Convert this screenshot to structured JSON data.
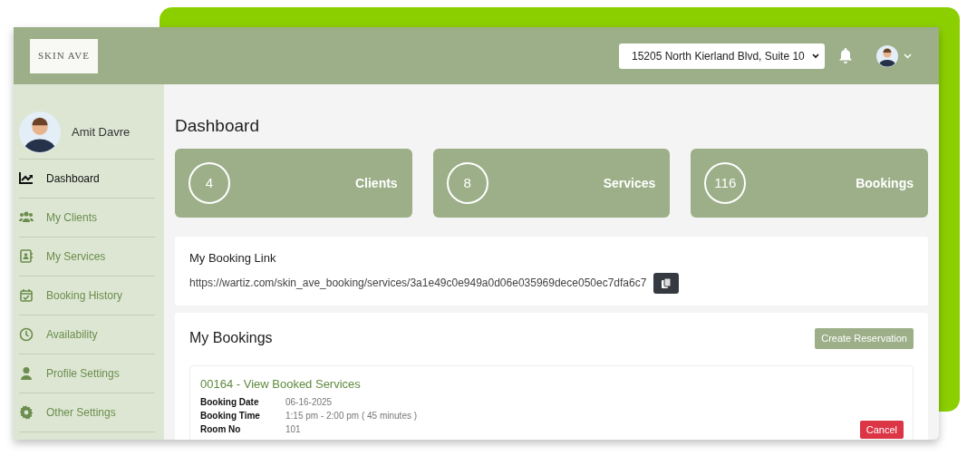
{
  "logo": "SKIN AVE",
  "header": {
    "location": "15205 North Kierland Blvd, Suite 10"
  },
  "sidebar": {
    "user_name": "Amit Davre",
    "items": [
      {
        "label": "Dashboard",
        "selected": true
      },
      {
        "label": "My Clients",
        "selected": false
      },
      {
        "label": "My Services",
        "selected": false
      },
      {
        "label": "Booking History",
        "selected": false
      },
      {
        "label": "Availability",
        "selected": false
      },
      {
        "label": "Profile Settings",
        "selected": false
      },
      {
        "label": "Other Settings",
        "selected": false
      }
    ]
  },
  "page_title": "Dashboard",
  "stats": [
    {
      "count": "4",
      "title": "Clients"
    },
    {
      "count": "8",
      "title": "Services"
    },
    {
      "count": "116",
      "title": "Bookings"
    }
  ],
  "booking_link": {
    "title": "My Booking Link",
    "url": "https://wartiz.com/skin_ave_booking/services/3a1e49c0e949a0d06e035969dece050ec7dfa6c7"
  },
  "bookings": {
    "title": "My Bookings",
    "create_button": "Create Reservation",
    "items": [
      {
        "title": "00164 - View Booked Services",
        "fields": [
          {
            "label": "Booking Date",
            "value": "06-16-2025"
          },
          {
            "label": "Booking Time",
            "value": "1:15 pm - 2:00 pm ( 45 minutes )"
          },
          {
            "label": "Room No",
            "value": "101"
          }
        ],
        "cancel_button": "Cancel"
      }
    ]
  }
}
